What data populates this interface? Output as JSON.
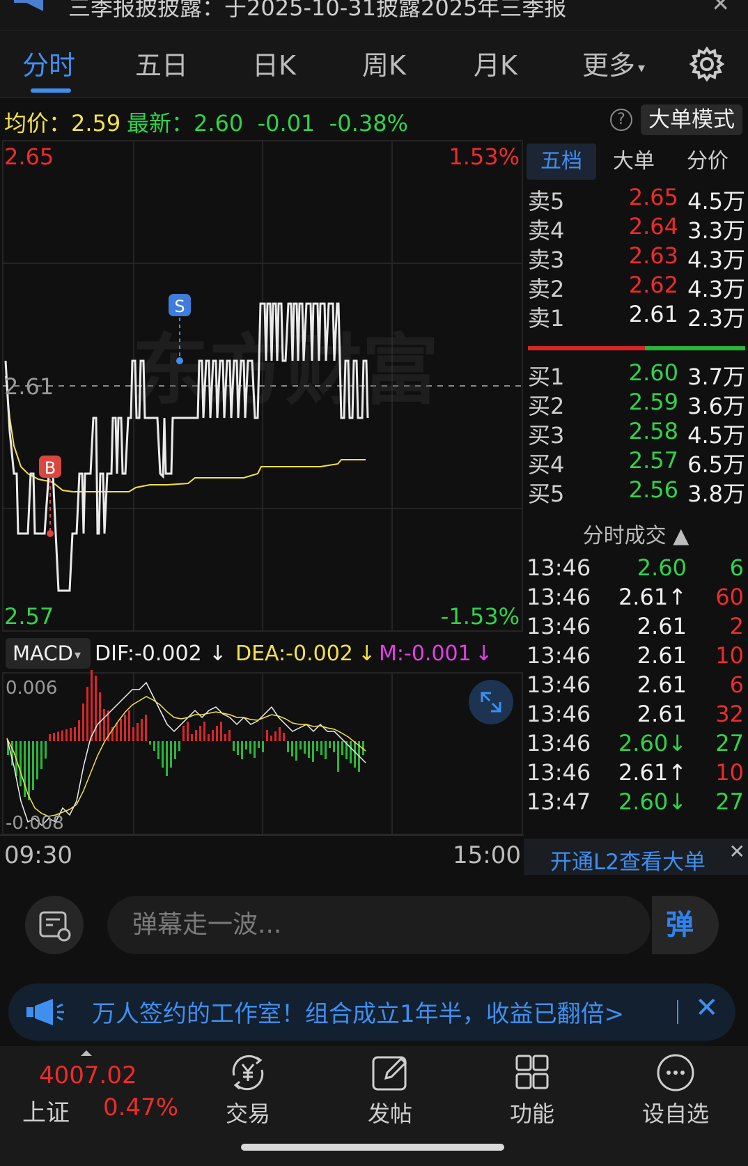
{
  "notice_top": {
    "text": "三季报披披露：于2025-10-31披露2025年三季报",
    "close": "✕"
  },
  "tabs": [
    {
      "label": "分时",
      "active": true
    },
    {
      "label": "五日"
    },
    {
      "label": "日K"
    },
    {
      "label": "周K"
    },
    {
      "label": "月K"
    },
    {
      "label": "更多"
    }
  ],
  "infobar": {
    "avg_label": "均价：",
    "avg_value": "2.59",
    "last_label": "最新：",
    "last_value": "2.60",
    "change": "-0.01",
    "change_pct": "-0.38%",
    "help": "?",
    "big_order_btn": "大单模式"
  },
  "chart": {
    "top_price": "2.65",
    "top_pct": "1.53%",
    "mid_price": "2.61",
    "bottom_price": "2.57",
    "bottom_pct": "-1.53%",
    "marker_b": "B",
    "marker_s": "S",
    "watermark": "东方财富",
    "macd_btn": "MACD",
    "dif": "DIF:-0.002",
    "dea": "DEA:-0.002",
    "m": "M:-0.001",
    "macd_top": "0.006",
    "macd_bottom": "-0.008",
    "time_start": "09:30",
    "time_end": "15:00"
  },
  "colors": {
    "up": "#ef2b2b",
    "down": "#2fd44a",
    "accent": "#3f8ff0",
    "avg": "#f3e24a",
    "macd_m": "#e53ee8"
  },
  "orderbook": {
    "tabs": [
      "五档",
      "大单",
      "分价"
    ],
    "sells": [
      {
        "label": "卖5",
        "price": "2.65",
        "vol": "4.5万"
      },
      {
        "label": "卖4",
        "price": "2.64",
        "vol": "3.3万"
      },
      {
        "label": "卖3",
        "price": "2.63",
        "vol": "4.3万"
      },
      {
        "label": "卖2",
        "price": "2.62",
        "vol": "4.3万"
      },
      {
        "label": "卖1",
        "price": "2.61",
        "vol": "2.3万"
      }
    ],
    "buys": [
      {
        "label": "买1",
        "price": "2.60",
        "vol": "3.7万"
      },
      {
        "label": "买2",
        "price": "2.59",
        "vol": "3.6万"
      },
      {
        "label": "买3",
        "price": "2.58",
        "vol": "4.5万"
      },
      {
        "label": "买4",
        "price": "2.57",
        "vol": "6.5万"
      },
      {
        "label": "买5",
        "price": "2.56",
        "vol": "3.8万"
      }
    ]
  },
  "ticks": {
    "title": "分时成交 ▲",
    "rows": [
      {
        "time": "13:46",
        "price": "2.60",
        "vol": "6"
      },
      {
        "time": "13:46",
        "price": "2.61↑",
        "vol": "60"
      },
      {
        "time": "13:46",
        "price": "2.61",
        "vol": "2"
      },
      {
        "time": "13:46",
        "price": "2.61",
        "vol": "10"
      },
      {
        "time": "13:46",
        "price": "2.61",
        "vol": "6"
      },
      {
        "time": "13:46",
        "price": "2.61",
        "vol": "32"
      },
      {
        "time": "13:46",
        "price": "2.60↓",
        "vol": "27"
      },
      {
        "time": "13:46",
        "price": "2.61↑",
        "vol": "10"
      },
      {
        "time": "13:47",
        "price": "2.60↓",
        "vol": "27"
      }
    ]
  },
  "l2": {
    "text": "开通L2查看大单",
    "close": "✕"
  },
  "danmu": {
    "placeholder": "弹幕走一波...",
    "send": "弹"
  },
  "ad": {
    "text": "万人签约的工作室！组合成立1年半，收益已翻倍>",
    "close": "✕"
  },
  "bottom": {
    "index_value": "4007.02",
    "index_name": "上证",
    "index_pct": "0.47%",
    "nav": [
      {
        "label": "交易",
        "icon": "yen-exchange-icon"
      },
      {
        "label": "发帖",
        "icon": "edit-icon"
      },
      {
        "label": "功能",
        "icon": "grid-icon"
      },
      {
        "label": "设自选",
        "icon": "more-circle-icon"
      }
    ]
  }
}
